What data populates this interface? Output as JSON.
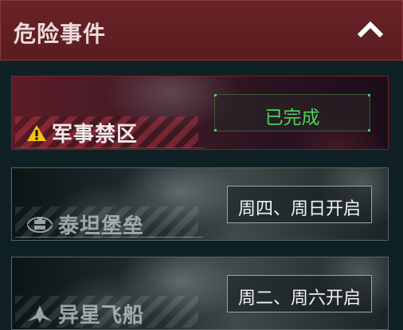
{
  "header": {
    "title": "危险事件",
    "collapse_icon": "chevron-up-icon"
  },
  "events": [
    {
      "name": "军事禁区",
      "icon": "warning-triangle-icon",
      "status": "已完成",
      "status_color": "#4ad35a",
      "active": true
    },
    {
      "name": "泰坦堡垒",
      "icon": "fortress-emblem-icon",
      "status": "周四、周日开启",
      "active": false
    },
    {
      "name": "异星飞船",
      "icon": "spaceship-emblem-icon",
      "status": "周二、周六开启",
      "active": false
    }
  ],
  "colors": {
    "header_bg": "#5a1c20",
    "page_bg": "#0f2125",
    "done_green": "#4ad35a",
    "warning_yellow": "#f2c318",
    "active_border": "#7a2228"
  }
}
